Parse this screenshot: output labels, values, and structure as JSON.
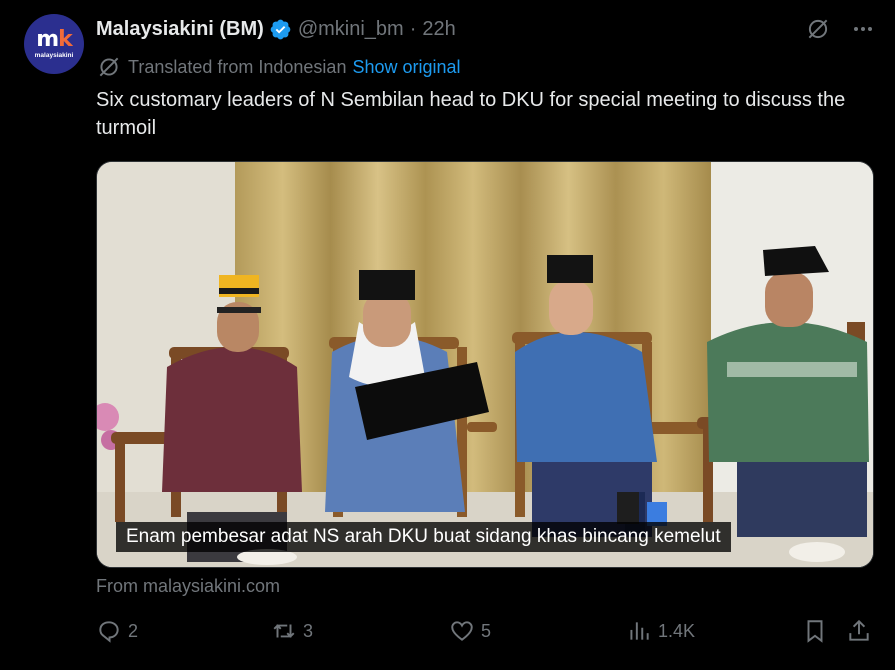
{
  "author": {
    "display_name": "Malaysiakini (BM)",
    "handle": "@mkini_bm",
    "separator": "·",
    "time": "22h",
    "avatar_mark_m": "m",
    "avatar_mark_k": "k",
    "avatar_word": "malaysiakini",
    "verified": true
  },
  "translation": {
    "label": "Translated from Indonesian",
    "action": "Show original"
  },
  "tweet": {
    "text": "Six customary leaders of N Sembilan head to DKU for special meeting to discuss the turmoil"
  },
  "media": {
    "caption": "Enam pembesar adat NS arah DKU buat sidang khas bincang kemelut"
  },
  "card": {
    "source": "From malaysiakini.com"
  },
  "actions": {
    "replies": "2",
    "reposts": "3",
    "likes": "5",
    "views": "1.4K"
  },
  "icons": {
    "verified": "verified-badge-icon",
    "grok": "grok-icon",
    "more": "more-icon",
    "translate": "translate-icon",
    "reply": "reply-icon",
    "repost": "repost-icon",
    "like": "heart-icon",
    "views": "views-icon",
    "bookmark": "bookmark-icon",
    "share": "share-icon"
  },
  "colors": {
    "background": "#000000",
    "text": "#e7e9ea",
    "muted": "#71767b",
    "accent": "#1d9bf0",
    "avatar": "#2b2f8f"
  }
}
